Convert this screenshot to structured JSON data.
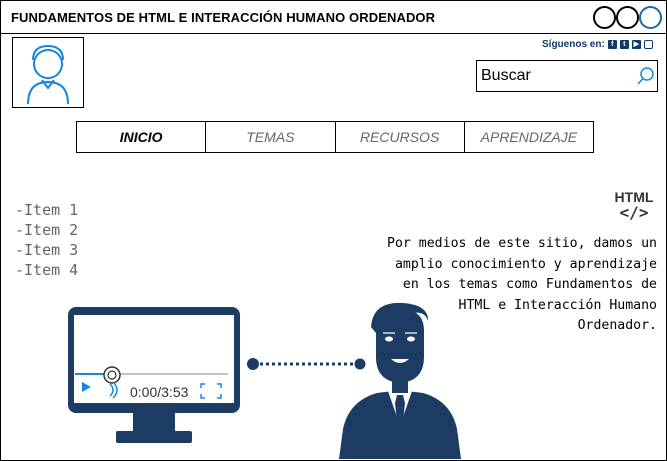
{
  "window": {
    "title": "FUNDAMENTOS DE HTML E INTERACCIÓN HUMANO ORDENADOR"
  },
  "social": {
    "label": "Síguenos en:",
    "icons": [
      "facebook-icon",
      "twitter-icon",
      "youtube-icon",
      "instagram-icon"
    ]
  },
  "search": {
    "value": "Buscar"
  },
  "nav": {
    "tabs": [
      "INICIO",
      "TEMAS",
      "RECURSOS",
      "APRENDIZAJE"
    ],
    "active": "INICIO"
  },
  "items": [
    "-Item 1",
    "-Item 2",
    "-Item 3",
    "-Item 4"
  ],
  "badge": {
    "line1": "HTML",
    "line2": "</>"
  },
  "description": "Por medios de este sitio, damos un amplio conocimiento y aprendizaje en los temas como Fundamentos de HTML e Interacción Humano Ordenador.",
  "video": {
    "time": "0:00/3:53",
    "progress": 0
  },
  "colors": {
    "navy": "#1c3c63",
    "accent": "#1a86e0",
    "dots": "#0f3a66"
  }
}
